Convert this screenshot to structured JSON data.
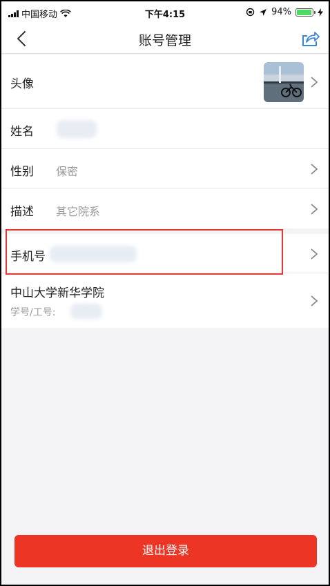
{
  "status_bar": {
    "carrier": "中国移动",
    "time": "下午4:15",
    "battery_percent": "94%",
    "battery_level": 0.94
  },
  "nav": {
    "title": "账号管理",
    "back_icon": "chevron-left-icon",
    "share_icon": "share-icon"
  },
  "rows": {
    "avatar_label": "头像",
    "name_label": "姓名",
    "gender_label": "性别",
    "gender_value": "保密",
    "desc_label": "描述",
    "desc_value": "其它院系",
    "phone_label": "手机号",
    "school_label": "中山大学新华学院",
    "student_id_label": "学号/工号:"
  },
  "logout_label": "退出登录",
  "colors": {
    "accent": "#ec3524",
    "highlight": "#e53935",
    "battery": "#4cd964"
  }
}
